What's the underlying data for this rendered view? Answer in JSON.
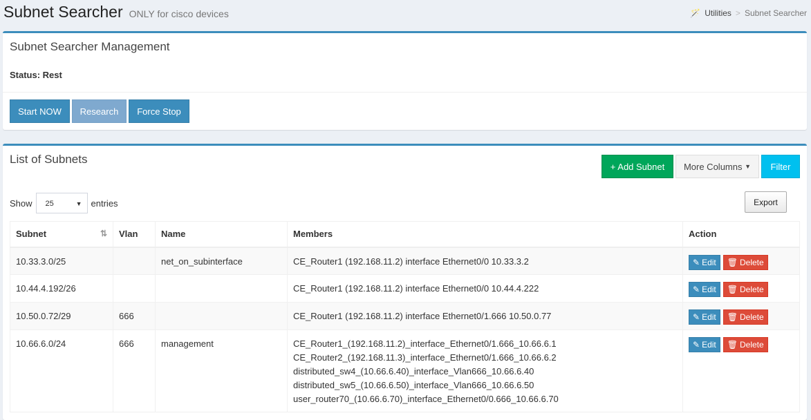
{
  "header": {
    "title": "Subnet Searcher",
    "subtitle": "ONLY for cisco devices"
  },
  "breadcrumb": {
    "icon": "magic-wand-icon",
    "items": [
      "Utilities",
      "Subnet Searcher"
    ],
    "separator": ">"
  },
  "management": {
    "title": "Subnet Searcher Management",
    "status": "Status: Rest",
    "buttons": [
      "Start NOW",
      "Research",
      "Force Stop"
    ]
  },
  "list": {
    "title": "List of Subnets",
    "add_label": "+ Add Subnet",
    "more_columns_label": "More Columns",
    "filter_label": "Filter",
    "show_label": "Show",
    "entries_label": "entries",
    "page_size": "25",
    "export_label": "Export",
    "columns": [
      "Subnet",
      "Vlan",
      "Name",
      "Members",
      "Action"
    ],
    "rows": [
      {
        "subnet": "10.33.3.0/25",
        "vlan": "",
        "name": "net_on_subinterface",
        "members": [
          "CE_Router1 (192.168.11.2) interface Ethernet0/0 10.33.3.2"
        ]
      },
      {
        "subnet": "10.44.4.192/26",
        "vlan": "",
        "name": "",
        "members": [
          "CE_Router1 (192.168.11.2) interface Ethernet0/0 10.44.4.222"
        ]
      },
      {
        "subnet": "10.50.0.72/29",
        "vlan": "666",
        "name": "",
        "members": [
          "CE_Router1 (192.168.11.2) interface Ethernet0/1.666 10.50.0.77"
        ]
      },
      {
        "subnet": "10.66.6.0/24",
        "vlan": "666",
        "name": "management",
        "members": [
          "CE_Router1_(192.168.11.2)_interface_Ethernet0/1.666_10.66.6.1",
          "CE_Router2_(192.168.11.3)_interface_Ethernet0/1.666_10.66.6.2",
          "distributed_sw4_(10.66.6.40)_interface_Vlan666_10.66.6.40",
          "distributed_sw5_(10.66.6.50)_interface_Vlan666_10.66.6.50",
          "user_router70_(10.66.6.70)_interface_Ethernet0/0.666_10.66.6.70"
        ]
      }
    ],
    "edit_label": "Edit",
    "delete_label": "Delete"
  },
  "colors": {
    "primary": "#3c8dbc",
    "success": "#00a65a",
    "info": "#00c0ef",
    "danger": "#dd4b39"
  }
}
